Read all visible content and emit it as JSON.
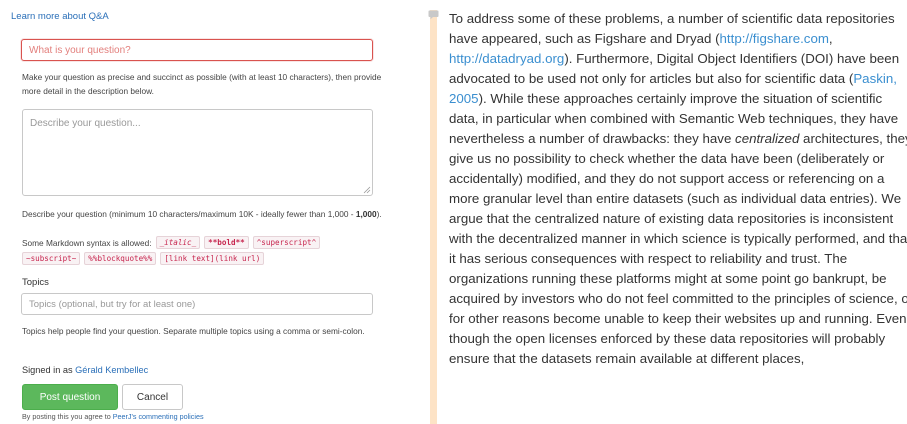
{
  "form": {
    "learn_more": "Learn more about Q&A",
    "question_placeholder": "What is your question?",
    "question_help": "Make your question as precise and succinct as possible (with at least 10 characters), then provide more detail in the description below.",
    "description_placeholder": "Describe your question...",
    "description_help_pre": "Describe your question (minimum 10 characters/maximum 10K - ideally fewer than 1,000 - ",
    "description_help_bold": "1,000",
    "description_help_post": ").",
    "markdown_intro": "Some Markdown syntax is allowed:",
    "markdown_examples": [
      "_italic_",
      "**bold**",
      "^superscript^",
      "~subscript~",
      "%%blockquote%%",
      "[link text](link url)"
    ],
    "topics_label": "Topics",
    "topics_placeholder": "Topics (optional, but try for at least one)",
    "topics_help": "Topics help people find your question. Separate multiple topics using a comma or semi-colon.",
    "signed_in_prefix": "Signed in as",
    "signed_in_user": "Gérald Kembellec",
    "post_button": "Post question",
    "cancel_button": "Cancel",
    "agree_prefix": "By posting this you agree to",
    "agree_link": "PeerJ's commenting policies"
  },
  "article": {
    "accent_color": "#fde3c6",
    "link_color": "#3b8fd0",
    "t1": "To address some of these problems, a number of scientific data repositories have appeared, such as Figshare and Dryad (",
    "link_figshare": "http://figshare.com",
    "t2": ", ",
    "link_dryad": "http://datadryad.org",
    "t3": "). Furthermore, Digital Object Identifiers (DOI) have been advocated to be used not only for articles but also for scientific data (",
    "link_paskin": "Paskin, 2005",
    "t4": "). While these approaches certainly improve the situation of scientific data, in particular when combined with Semantic Web techniques, they have nevertheless a number of drawbacks: they have ",
    "em_centralized": "centralized",
    "t5": " architectures, they give us no possibility to check whether the data have been (deliberately or accidentally) modified, and they do not support access or referencing on a more granular level than entire datasets (such as individual data entries). We argue that the centralized nature of existing data repositories is inconsistent with the decentralized manner in which science is typically performed, and that it has serious consequences with respect to reliability and trust. The organizations running these platforms might at some point go bankrupt, be acquired by investors who do not feel committed to the principles of science, or for other reasons become unable to keep their websites up and running. Even though the open licenses enforced by these data repositories will probably ensure that the datasets remain available at different places,"
  }
}
